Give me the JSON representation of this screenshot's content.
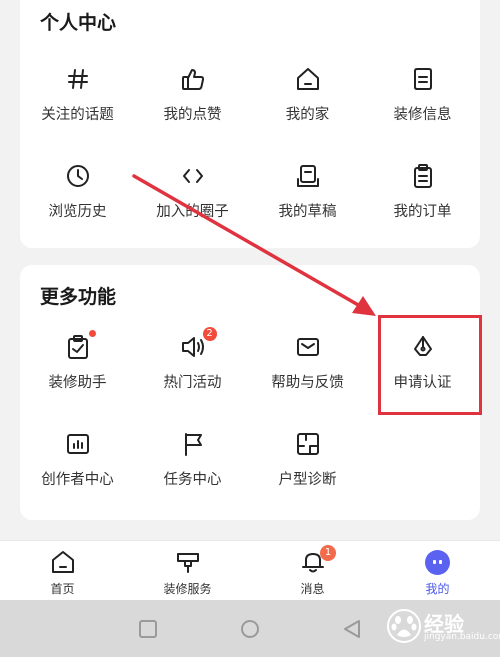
{
  "personal": {
    "title": "个人中心",
    "items": [
      {
        "label": "关注的话题",
        "icon": "hash-icon"
      },
      {
        "label": "我的点赞",
        "icon": "thumbs-up-icon"
      },
      {
        "label": "我的家",
        "icon": "house-icon"
      },
      {
        "label": "装修信息",
        "icon": "document-icon"
      },
      {
        "label": "浏览历史",
        "icon": "clock-icon"
      },
      {
        "label": "加入的圈子",
        "icon": "code-brackets-icon"
      },
      {
        "label": "我的草稿",
        "icon": "draft-icon"
      },
      {
        "label": "我的订单",
        "icon": "clipboard-icon"
      }
    ]
  },
  "more": {
    "title": "更多功能",
    "items": [
      {
        "label": "装修助手",
        "icon": "assistant-clipboard-icon",
        "dot": true
      },
      {
        "label": "热门活动",
        "icon": "megaphone-icon",
        "badge": "2"
      },
      {
        "label": "帮助与反馈",
        "icon": "mail-icon"
      },
      {
        "label": "申请认证",
        "icon": "pen-nib-icon"
      },
      {
        "label": "创作者中心",
        "icon": "chart-icon"
      },
      {
        "label": "任务中心",
        "icon": "flag-icon"
      },
      {
        "label": "户型诊断",
        "icon": "floorplan-icon"
      }
    ]
  },
  "tabbar": {
    "items": [
      {
        "label": "首页",
        "icon": "home-icon"
      },
      {
        "label": "装修服务",
        "icon": "service-icon"
      },
      {
        "label": "消息",
        "icon": "bell-icon",
        "badge": "1"
      },
      {
        "label": "我的",
        "icon": "avatar-icon",
        "active": true
      }
    ]
  },
  "watermark": {
    "brand": "经验",
    "url": "jingyan.baidu.com"
  },
  "colors": {
    "accent": "#4a58e8",
    "badge": "#f24a3b",
    "highlight": "#e03340"
  }
}
